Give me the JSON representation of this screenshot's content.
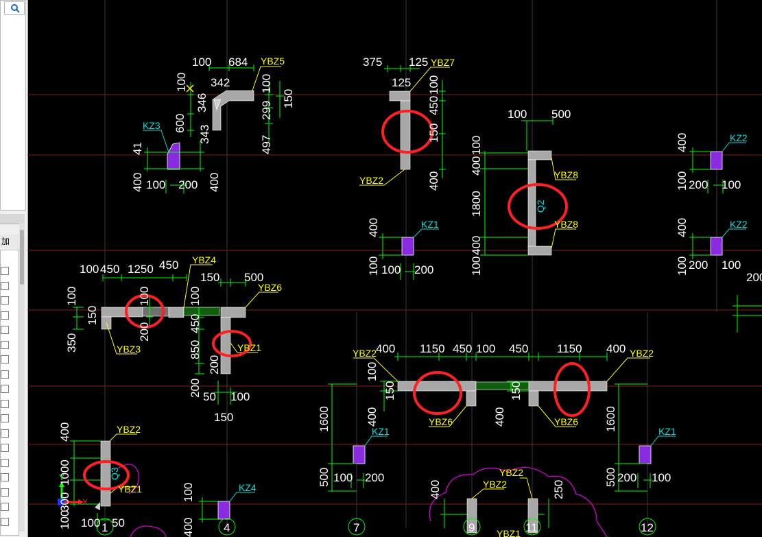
{
  "left_panel": {
    "search_icon": "search-icon",
    "column_header": "加",
    "row_checkboxes": 18
  },
  "colors": {
    "background": "#000000",
    "wall": "#a8a8a8",
    "column": "#8a2be2",
    "dimension": "#00ff00",
    "leader_yellow": "#ffff00",
    "leader_cyan": "#00e0e0",
    "grid_red": "#8b1a1a",
    "grid_gray": "#3a3a3a",
    "highlight_circle": "#ff2020",
    "revision_cloud": "#e000e0"
  },
  "labels": {
    "kz3": "KZ3",
    "kz1a": "KZ1",
    "kz1b": "KZ1",
    "kz1c": "KZ1",
    "kz2a": "KZ2",
    "kz2b": "KZ2",
    "kz4": "KZ4",
    "ybz5": "YBZ5",
    "ybz7": "YBZ7",
    "ybz2a": "YBZ2",
    "ybz8a": "YBZ8",
    "ybz8b": "YBZ8",
    "q2": "Q2",
    "ybz4": "YBZ4",
    "ybz6a": "YBZ6",
    "ybz3": "YBZ3",
    "ybz1a": "YBZ1",
    "ybz2b": "YBZ2",
    "ybz2c": "YBZ2",
    "ybz6b": "YBZ6",
    "ybz6c": "YBZ6",
    "ybz2d": "YBZ2",
    "q3": "Q3",
    "ybz1b": "YBZ1",
    "ybz2e": "YBZ2",
    "ybz2f": "YBZ2",
    "ybz1c": "YBZ1",
    "axis_x": "X",
    "axis_y": "Y"
  },
  "dims": {
    "d1": "100",
    "d2": "684",
    "d3": "342",
    "d4": "100",
    "d5": "100",
    "d6": "150",
    "d7": "346",
    "d8": "299",
    "d9": "600",
    "d10": "343",
    "d11": "497",
    "d12": "41",
    "d13": "400",
    "d14": "100",
    "d15": "200",
    "d16": "400",
    "d17": "375",
    "d18": "125",
    "d19": "125",
    "d20": "100",
    "d21": "450",
    "d22": "150",
    "d23": "400",
    "d24": "100",
    "d25": "500",
    "d26": "100",
    "d27": "400",
    "d28": "1800",
    "d29": "400",
    "d30": "100",
    "d31": "400",
    "d32": "100",
    "d33": "100",
    "d34": "200",
    "d35": "400",
    "d36": "100",
    "d37": "200",
    "d38": "100",
    "d39": "400",
    "d40": "100",
    "d41": "200",
    "d42": "100",
    "d43": "200",
    "d44": "100",
    "d45": "450",
    "d46": "1250",
    "d47": "450",
    "d48": "100",
    "d49": "150",
    "d50": "100",
    "d51": "350",
    "d52": "200",
    "d53": "150",
    "d54": "500",
    "d55": "100",
    "d56": "450",
    "d57": "850",
    "d58": "200",
    "d59": "200",
    "d60": "50",
    "d61": "100",
    "d62": "150",
    "d63": "400",
    "d64": "1150",
    "d65": "450",
    "d66": "100",
    "d67": "450",
    "d68": "1150",
    "d69": "400",
    "d70": "100",
    "d71": "150",
    "d72": "400",
    "d73": "1600",
    "d74": "500",
    "d75": "100",
    "d76": "200",
    "d77": "150",
    "d78": "400",
    "d79": "1600",
    "d80": "500",
    "d81": "200",
    "d82": "100",
    "d83": "400",
    "d84": "1000",
    "d85": "300",
    "d86": "100",
    "d87": "100",
    "d88": "50",
    "d89": "100",
    "d90": "400",
    "d91": "400",
    "d92": "250"
  },
  "axes": {
    "a1": "1",
    "a4": "4",
    "a7": "7",
    "a9": "9",
    "a11": "11",
    "a12": "12"
  }
}
